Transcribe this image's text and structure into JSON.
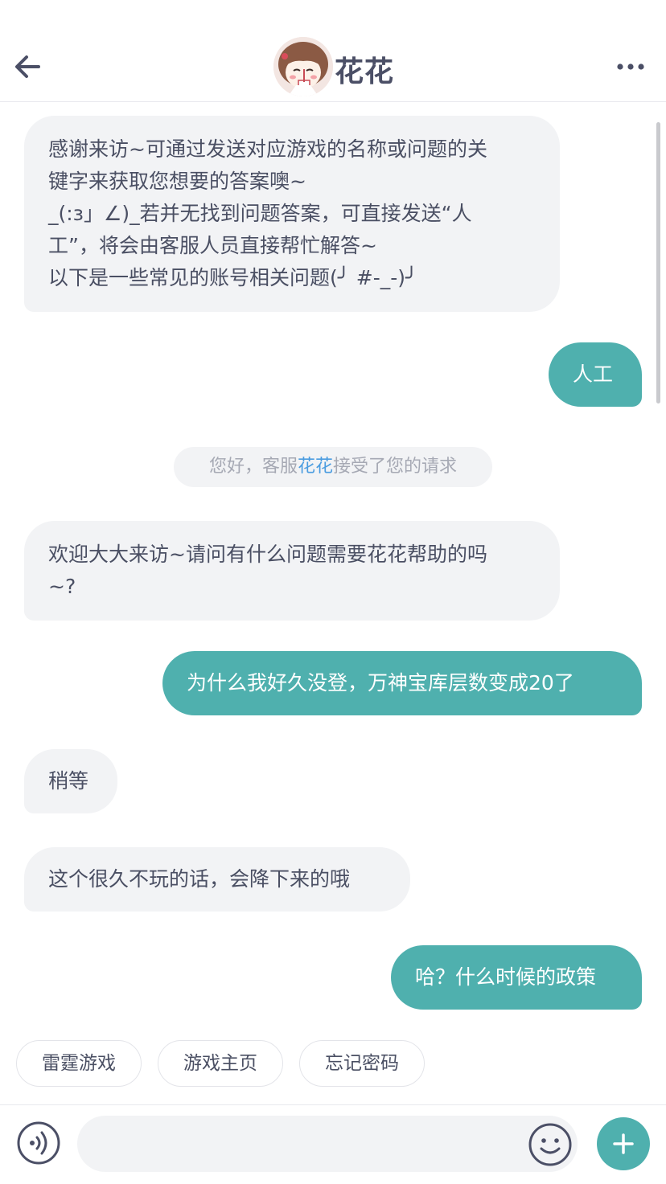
{
  "header": {
    "agent_name": "花花",
    "back_icon": "arrow-left-icon",
    "more_icon": "more-dots-icon"
  },
  "messages": [
    {
      "side": "in",
      "text": "感谢来访~可通过发送对应游戏的名称或问题的关\n键字来获取您想要的答案噢~\n_(:з」∠)_若并无找到问题答案，可直接发送“人\n工”，将会由客服人员直接帮忙解答~\n以下是一些常见的账号相关问题(╯ #-_-)╯"
    },
    {
      "side": "out",
      "text": "人工"
    },
    {
      "side": "in",
      "text": "欢迎大大来访~请问有什么问题需要花花帮助的吗\n~?"
    },
    {
      "side": "out",
      "text": "为什么我好久没登，万神宝库层数变成20了"
    },
    {
      "side": "in",
      "text": "稍等"
    },
    {
      "side": "in",
      "text": "这个很久不玩的话，会降下来的哦"
    },
    {
      "side": "out",
      "text": "哈？什么时候的政策"
    }
  ],
  "system_note": {
    "prefix": "您好，客服",
    "highlight": "花花",
    "suffix": "接受了您的请求"
  },
  "quick_replies": [
    "雷霆游戏",
    "游戏主页",
    "忘记密码"
  ],
  "input": {
    "value": "",
    "placeholder": "",
    "voice_icon": "voice-icon",
    "emoji_icon": "emoji-icon",
    "plus_icon": "plus-icon"
  },
  "colors": {
    "accent": "#4fb0ae",
    "incoming_bubble": "#f2f3f5",
    "highlight_text": "#4a9ce0"
  }
}
